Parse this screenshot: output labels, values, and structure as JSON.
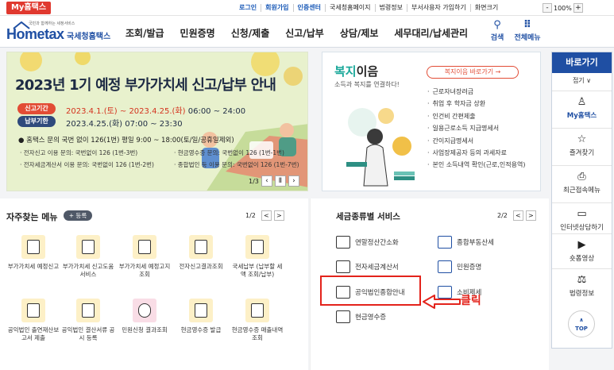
{
  "topbar": {
    "my_hometax": "My홈택스",
    "links": [
      "로그인",
      "회원가입",
      "인증센터",
      "국세청홈페이지",
      "법령정보",
      "부서사용자 가입하기",
      "화면크기"
    ],
    "zoom_value": "100%",
    "zoom_minus": "-",
    "zoom_plus": "+"
  },
  "header": {
    "logo_sub": "국민과 함께하는 세정서비스",
    "logo_main": "Hometax",
    "logo_kr": "국세청홈택스",
    "nav": [
      "조회/발급",
      "민원증명",
      "신청/제출",
      "신고/납부",
      "상담/제보",
      "세무대리/납세관리"
    ],
    "search_label": "검색",
    "menu_label": "전체메뉴"
  },
  "banner": {
    "title": "2023년 1기 예정 부가가치세 신고/납부 안내",
    "period1_label": "신고기간",
    "period1_value_red": "2023.4.1.(토) ~ 2023.4.25.(화)",
    "period1_value": "06:00 ~ 24:00",
    "period2_label": "납부기한",
    "period2_value": "2023.4.25.(화) 07:00 ~ 23:30",
    "note": "● 홈택스 문의 국번 없이 126(1번) 평일 9:00 ~ 18:00(토/일/공휴일제외)",
    "sub1": "· 전자신고 이용 문의: 국번없이 126 (1번-3번)",
    "sub2": "· 현금영수증 문의: 국번없이 126 (1번-1번)",
    "sub3": "· 전자세금계산서 이용 문의: 국번없이 126 (1번-2번)",
    "sub4": "· 종합법인 등 이용 문의: 국번없이 126 (1번-7번)",
    "page": "1/3",
    "prev": "‹",
    "pause": "Ⅱ",
    "next": "›"
  },
  "welfare": {
    "title_a": "복지",
    "title_b": "이음",
    "subtitle": "소득과 복지를 연결하다!",
    "button": "복지이음 바로가기 →",
    "items": [
      "근로자녀장려금",
      "취업 후 학자금 상환",
      "인건비 간편제출",
      "일용근로소득 지급명세서",
      "간이지급명세서",
      "사업장제공자 등의 과세자료",
      "본인 소득내역 확인(근로,인적용역)"
    ]
  },
  "quick": {
    "header": "바로가기",
    "fold": "접기 ∨",
    "items": [
      {
        "label": "My홈택스",
        "icon": "person-icon",
        "glyph": "♙"
      },
      {
        "label": "즐겨찾기",
        "icon": "star-icon",
        "glyph": "☆"
      },
      {
        "label": "최근접속메뉴",
        "icon": "recent-icon",
        "glyph": "⎙"
      },
      {
        "label": "인터넷상담하기",
        "icon": "chat-icon",
        "glyph": "▭"
      },
      {
        "label": "숏폼영상",
        "icon": "video-icon",
        "glyph": "▶"
      },
      {
        "label": "법령정보",
        "icon": "gavel-icon",
        "glyph": "⚖"
      }
    ],
    "top": "TOP"
  },
  "freq": {
    "title": "자주찾는 메뉴",
    "add": "+ 등록",
    "page": "1/2",
    "prev": "<",
    "next": ">",
    "items": [
      {
        "label": "부가가치세 예정신고"
      },
      {
        "label": "부가가치세 신고도움 서비스"
      },
      {
        "label": "부가가치세 예정고지 조회"
      },
      {
        "label": "전자신고결과조회"
      },
      {
        "label": "국세납부 (납부할 세액 조회/납부)"
      },
      {
        "label": "공익법인 출연재산보고서 제출"
      },
      {
        "label": "공익법인 결산서류 공시 등록"
      },
      {
        "label": "민원신청 결과조회"
      },
      {
        "label": "현금영수증 발급"
      },
      {
        "label": "현금영수증 매출내역 조회"
      }
    ]
  },
  "tax": {
    "title": "세금종류별 서비스",
    "page": "2/2",
    "prev": "<",
    "next": ">",
    "items": [
      "연말정산간소화",
      "종합부동산세",
      "전자세금계산서",
      "민원증명",
      "공익법인종합안내",
      "소비제세",
      "현금영수증"
    ],
    "callout": "클릭"
  }
}
